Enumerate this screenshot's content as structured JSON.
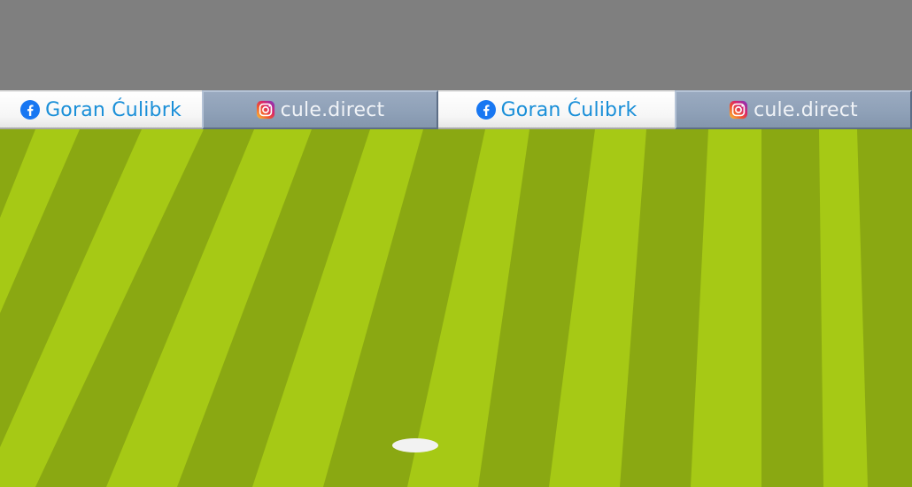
{
  "banner": {
    "facebook_name": "Goran Ćulibrk",
    "instagram_handle": "cule.direct"
  },
  "colors": {
    "sky": "#7f7f7f",
    "grass_light": "#a6c915",
    "grass_dark": "#8aa812",
    "facebook_text": "#1a8fd8",
    "instagram_button": "#8ea0b7",
    "ball": "#f2f2f2"
  },
  "icons": {
    "facebook": "facebook-icon",
    "instagram": "instagram-icon"
  }
}
